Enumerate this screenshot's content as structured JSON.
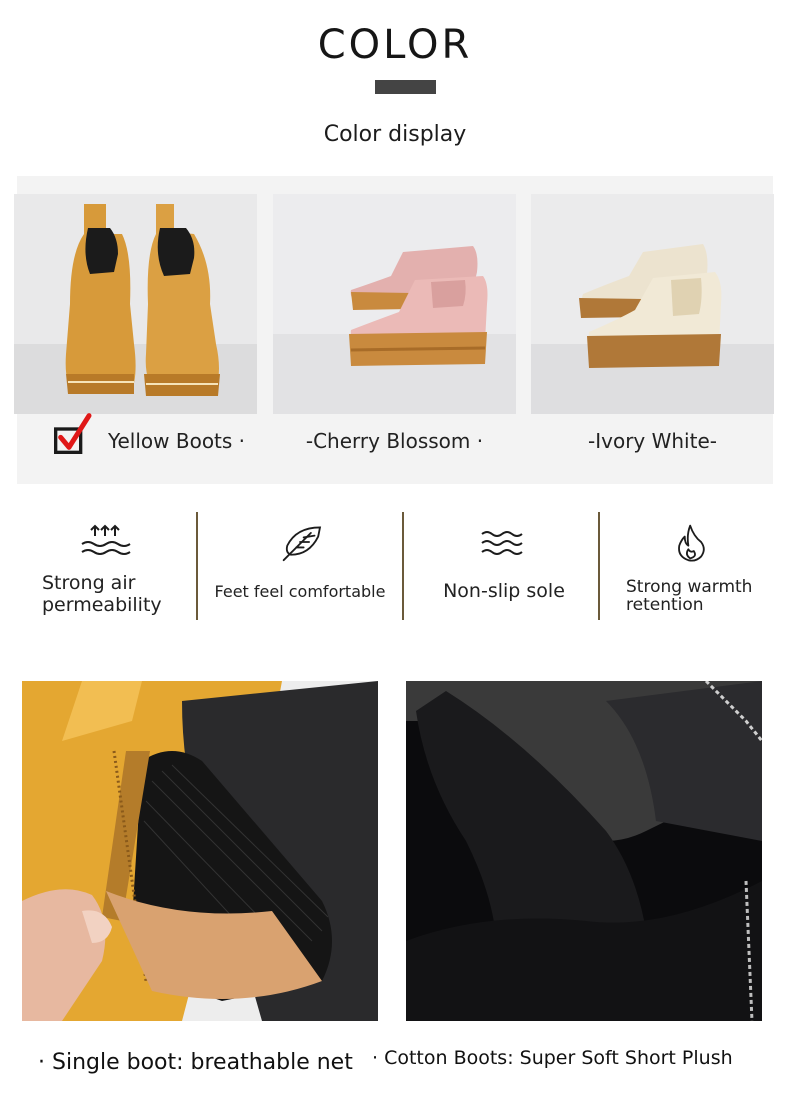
{
  "header": {
    "title": "COLOR",
    "subtitle": "Color display"
  },
  "swatches": [
    {
      "label": "Yellow Boots ·",
      "selected": true,
      "color": "#d89a3c"
    },
    {
      "label": "-Cherry Blossom ·",
      "selected": false,
      "color": "#e8b6b4"
    },
    {
      "label": "-Ivory White-",
      "selected": false,
      "color": "#ece4d2"
    }
  ],
  "features": [
    {
      "icon": "air-waves-icon",
      "label_line1": "Strong air",
      "label_line2": "permeability"
    },
    {
      "icon": "feather-icon",
      "label_line1": "Feet feel comfortable",
      "label_line2": ""
    },
    {
      "icon": "wavy-lines-icon",
      "label_line1": "Non-slip sole",
      "label_line2": ""
    },
    {
      "icon": "flame-icon",
      "label_line1": "Strong warmth",
      "label_line2": "retention"
    }
  ],
  "details": [
    {
      "caption": "· Single boot: breathable net"
    },
    {
      "caption": "· Cotton Boots: Super Soft Short Plush"
    }
  ],
  "colors": {
    "accent_red": "#e01818",
    "divider": "#6b5a3a",
    "panel": "#f3f3f3"
  }
}
